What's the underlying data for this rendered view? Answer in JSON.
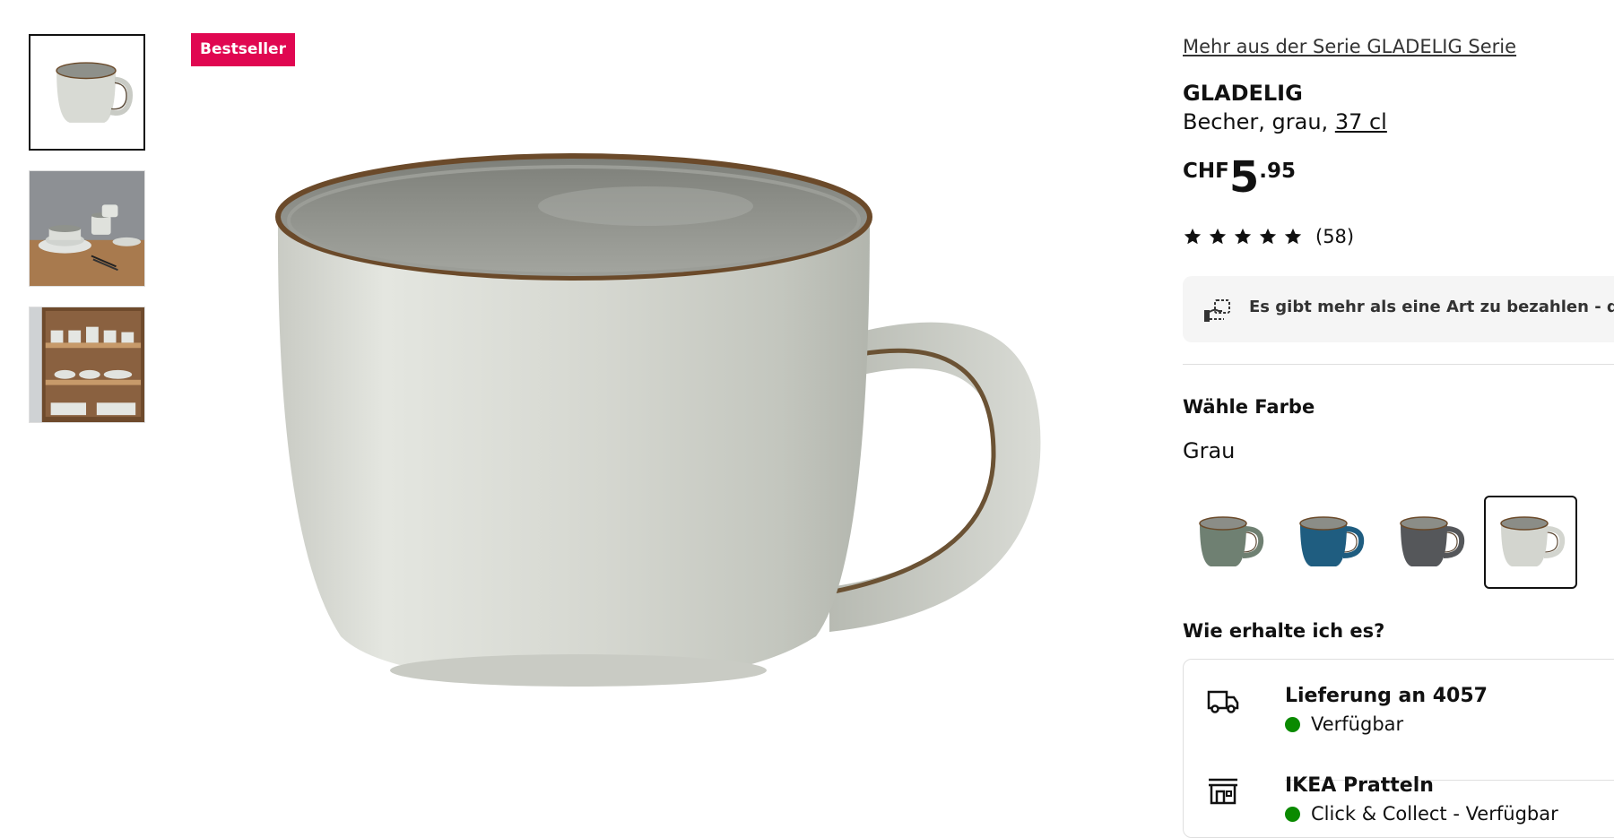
{
  "badge": {
    "label": "Bestseller"
  },
  "thumbnails": [
    {
      "name": "thumbnail-mug",
      "selected": true
    },
    {
      "name": "thumbnail-table-setting",
      "selected": false
    },
    {
      "name": "thumbnail-shelf",
      "selected": false
    }
  ],
  "product": {
    "series_link": "Mehr aus der Serie GLADELIG Serie",
    "name": "GLADELIG",
    "description": "Becher, grau, ",
    "size": "37 cl",
    "price": {
      "currency": "CHF",
      "integer": "5",
      "decimal": ".95"
    },
    "rating": {
      "stars": 5,
      "count": "(58)"
    }
  },
  "payment_banner": {
    "text": "Es gibt mehr als eine Art zu bezahlen - die IKEA"
  },
  "color": {
    "label": "Wähle Farbe",
    "selected": "Grau",
    "options": [
      {
        "name": "green",
        "body": "#6f8072",
        "selected": false
      },
      {
        "name": "blue",
        "body": "#1f5d80",
        "selected": false
      },
      {
        "name": "dark-grey",
        "body": "#55575a",
        "selected": false
      },
      {
        "name": "grey",
        "body": "#d3d5cf",
        "selected": true
      }
    ]
  },
  "delivery": {
    "label": "Wie erhalte ich es?",
    "options": [
      {
        "icon": "truck-icon",
        "title": "Lieferung an 4057",
        "status": "Verfügbar"
      },
      {
        "icon": "store-icon",
        "title": "IKEA Pratteln",
        "status": "Click & Collect - Verfügbar"
      }
    ]
  },
  "colors": {
    "badge": "#e00751",
    "available": "#0a8a00"
  }
}
